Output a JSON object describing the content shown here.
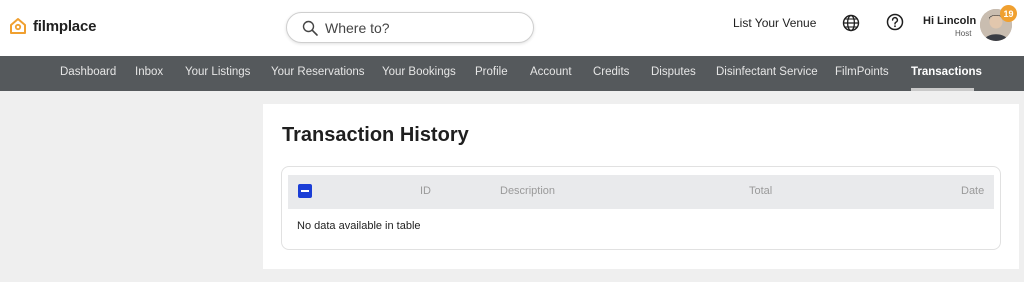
{
  "brand": {
    "name": "filmplace",
    "accent": "#f0a030"
  },
  "search": {
    "placeholder": "Where to?"
  },
  "header": {
    "list_venue": "List Your Venue",
    "greeting": "Hi Lincoln",
    "role": "Host",
    "notification_count": "19"
  },
  "nav": {
    "items": [
      {
        "label": "Dashboard"
      },
      {
        "label": "Inbox"
      },
      {
        "label": "Your Listings"
      },
      {
        "label": "Your Reservations"
      },
      {
        "label": "Your Bookings"
      },
      {
        "label": "Profile"
      },
      {
        "label": "Account"
      },
      {
        "label": "Credits"
      },
      {
        "label": "Disputes"
      },
      {
        "label": "Disinfectant Service"
      },
      {
        "label": "FilmPoints"
      },
      {
        "label": "Transactions"
      }
    ],
    "active": "Transactions"
  },
  "page": {
    "title": "Transaction History",
    "table": {
      "columns": [
        "ID",
        "Description",
        "Total",
        "Date"
      ],
      "empty_message": "No data available in table"
    }
  }
}
